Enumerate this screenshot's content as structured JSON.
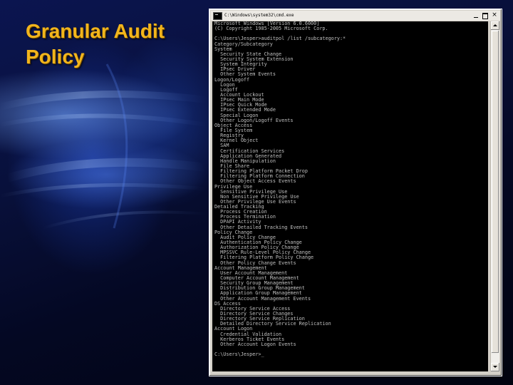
{
  "slide": {
    "title_lines": [
      "Granular Audit",
      "Policy"
    ]
  },
  "window": {
    "title": "C:\\Windows\\system32\\cmd.exe",
    "icon": "console-icon",
    "buttons": {
      "minimize": "minimize-icon",
      "maximize": "maximize-icon",
      "close": "×"
    }
  },
  "console": {
    "lines": [
      "Microsoft Windows [Version 6.0.6000]",
      "(C) Copyright 1985-2005 Microsoft Corp.",
      "",
      "C:\\Users\\Jesper>auditpol /list /subcategory:*",
      "Category/Subcategory",
      "System",
      "  Security State Change",
      "  Security System Extension",
      "  System Integrity",
      "  IPsec Driver",
      "  Other System Events",
      "Logon/Logoff",
      "  Logon",
      "  Logoff",
      "  Account Lockout",
      "  IPsec Main Mode",
      "  IPsec Quick Mode",
      "  IPsec Extended Mode",
      "  Special Logon",
      "  Other Logon/Logoff Events",
      "Object Access",
      "  File System",
      "  Registry",
      "  Kernel Object",
      "  SAM",
      "  Certification Services",
      "  Application Generated",
      "  Handle Manipulation",
      "  File Share",
      "  Filtering Platform Packet Drop",
      "  Filtering Platform Connection",
      "  Other Object Access Events",
      "Privilege Use",
      "  Sensitive Privilege Use",
      "  Non Sensitive Privilege Use",
      "  Other Privilege Use Events",
      "Detailed Tracking",
      "  Process Creation",
      "  Process Termination",
      "  DPAPI Activity",
      "  Other Detailed Tracking Events",
      "Policy Change",
      "  Audit Policy Change",
      "  Authentication Policy Change",
      "  Authorization Policy Change",
      "  MPSSVC Rule-Level Policy Change",
      "  Filtering Platform Policy Change",
      "  Other Policy Change Events",
      "Account Management",
      "  User Account Management",
      "  Computer Account Management",
      "  Security Group Management",
      "  Distribution Group Management",
      "  Application Group Management",
      "  Other Account Management Events",
      "DS Access",
      "  Directory Service Access",
      "  Directory Service Changes",
      "  Directory Service Replication",
      "  Detailed Directory Service Replication",
      "Account Logon",
      "  Credential Validation",
      "  Kerberos Ticket Events",
      "  Other Account Logon Events",
      "",
      "C:\\Users\\Jesper>_"
    ]
  },
  "scrollbar": {
    "up_icon": "scroll-up-arrow-icon",
    "down_icon": "scroll-down-arrow-icon"
  }
}
